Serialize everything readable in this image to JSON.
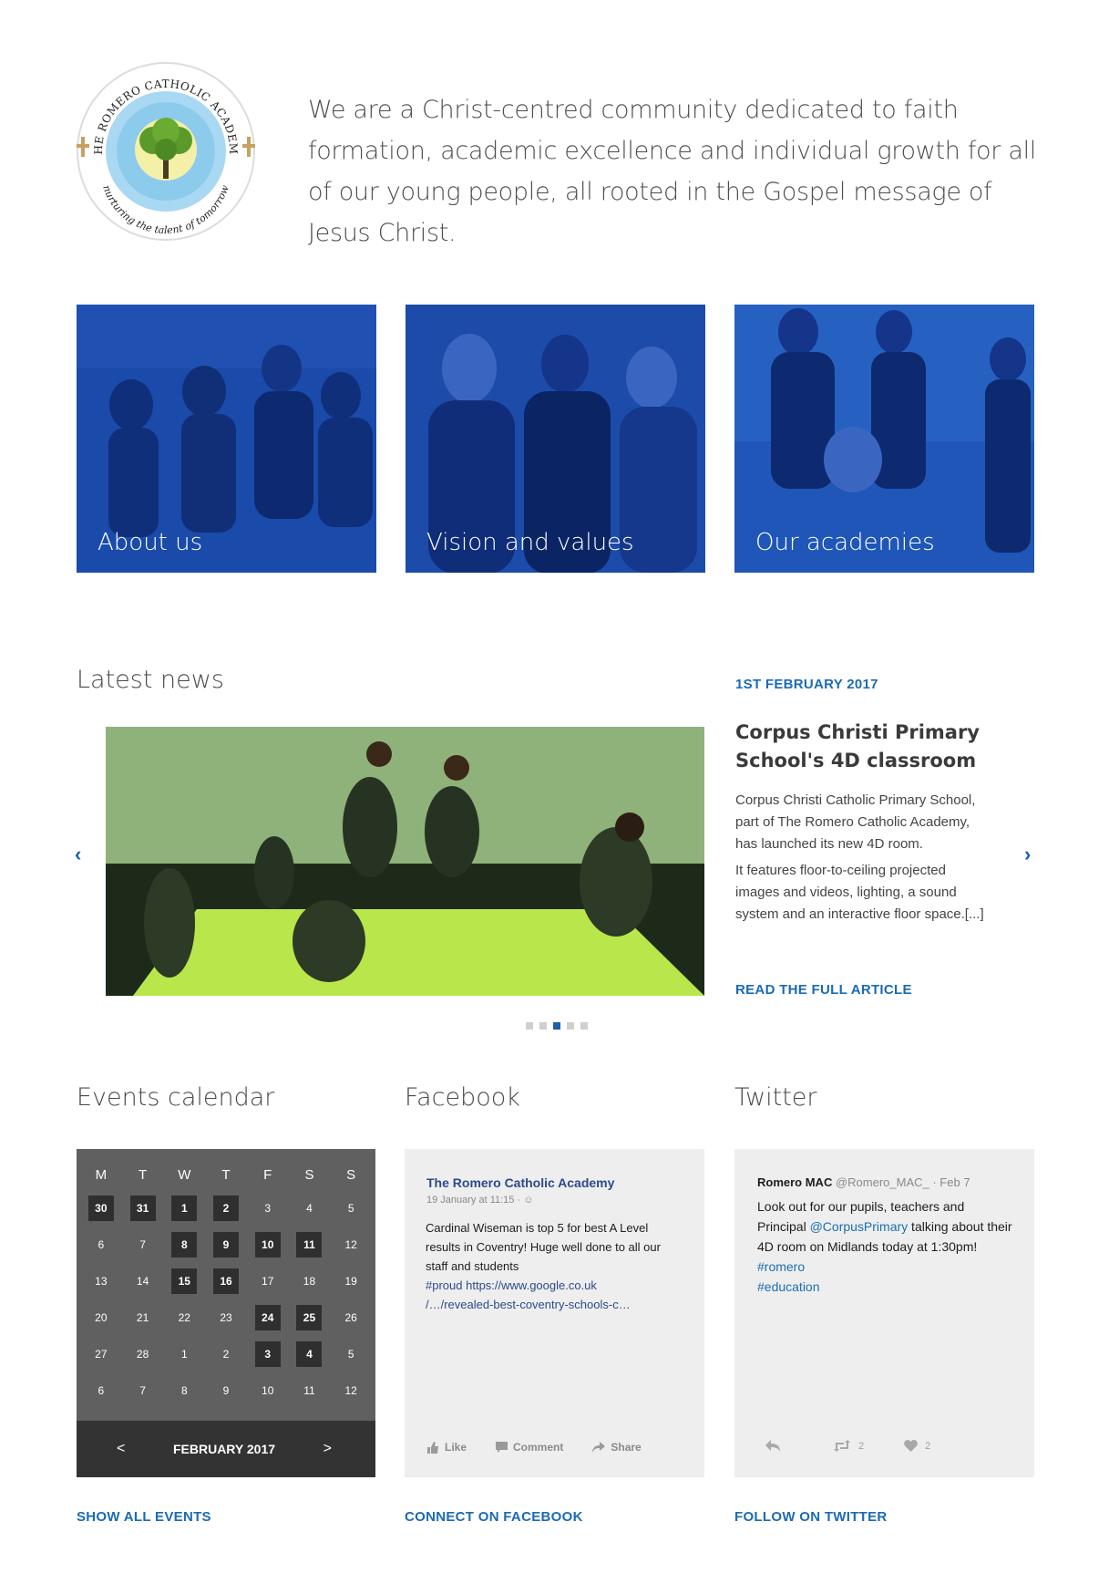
{
  "header": {
    "logo_text_top": "THE ROMERO CATHOLIC ACADEMY",
    "logo_text_bottom": "nurturing the talent of tomorrow",
    "mission": "We are a Christ-centred community dedicated to faith formation, academic excellence and individual growth for all of our young people, all rooted in the Gospel message of Jesus Christ."
  },
  "tiles": [
    {
      "label": "About us"
    },
    {
      "label": "Vision and values"
    },
    {
      "label": "Our academies"
    }
  ],
  "news": {
    "heading": "Latest news",
    "date": "1ST FEBRUARY 2017",
    "title": "Corpus Christi Primary School's 4D classroom",
    "body": [
      "Corpus Christi Catholic Primary School, part of The Romero Catholic Academy, has launched its new 4D room.",
      "It features floor-to-ceiling projected images and videos, lighting, a sound system and an interactive floor space.[...]"
    ],
    "read_more": "READ THE FULL ARTICLE",
    "prev": "‹",
    "next": "›",
    "slides": 5,
    "active_slide": 3
  },
  "events": {
    "heading": "Events calendar",
    "weekdays": [
      "M",
      "T",
      "W",
      "T",
      "F",
      "S",
      "S"
    ],
    "weeks": [
      [
        {
          "d": "30",
          "e": true
        },
        {
          "d": "31",
          "e": true
        },
        {
          "d": "1",
          "e": true
        },
        {
          "d": "2",
          "e": true
        },
        {
          "d": "3",
          "e": false
        },
        {
          "d": "4",
          "e": false
        },
        {
          "d": "5",
          "e": false
        }
      ],
      [
        {
          "d": "6",
          "e": false
        },
        {
          "d": "7",
          "e": false
        },
        {
          "d": "8",
          "e": true
        },
        {
          "d": "9",
          "e": true
        },
        {
          "d": "10",
          "e": true
        },
        {
          "d": "11",
          "e": true
        },
        {
          "d": "12",
          "e": false
        }
      ],
      [
        {
          "d": "13",
          "e": false
        },
        {
          "d": "14",
          "e": false
        },
        {
          "d": "15",
          "e": true
        },
        {
          "d": "16",
          "e": true
        },
        {
          "d": "17",
          "e": false
        },
        {
          "d": "18",
          "e": false
        },
        {
          "d": "19",
          "e": false
        }
      ],
      [
        {
          "d": "20",
          "e": false
        },
        {
          "d": "21",
          "e": false
        },
        {
          "d": "22",
          "e": false
        },
        {
          "d": "23",
          "e": false
        },
        {
          "d": "24",
          "e": true
        },
        {
          "d": "25",
          "e": true
        },
        {
          "d": "26",
          "e": false
        }
      ],
      [
        {
          "d": "27",
          "e": false
        },
        {
          "d": "28",
          "e": false
        },
        {
          "d": "1",
          "e": false
        },
        {
          "d": "2",
          "e": false
        },
        {
          "d": "3",
          "e": true
        },
        {
          "d": "4",
          "e": true
        },
        {
          "d": "5",
          "e": false
        }
      ],
      [
        {
          "d": "6",
          "e": false
        },
        {
          "d": "7",
          "e": false
        },
        {
          "d": "8",
          "e": false
        },
        {
          "d": "9",
          "e": false
        },
        {
          "d": "10",
          "e": false
        },
        {
          "d": "11",
          "e": false
        },
        {
          "d": "12",
          "e": false
        }
      ]
    ],
    "prev": "<",
    "next": ">",
    "month": "FEBRUARY 2017",
    "link": "SHOW ALL EVENTS"
  },
  "facebook": {
    "heading": "Facebook",
    "page_name": "The Romero Catholic Academy",
    "time": "19 January at 11:15 · ",
    "text": "Cardinal Wiseman is top 5 for best A Level results in Coventry! Huge well done to all our staff and students",
    "hashtag": "#proud",
    "url": "https://www.google.co.uk /…/revealed-best-coventry-schools-c…",
    "like": "Like",
    "comment": "Comment",
    "share": "Share",
    "link": "CONNECT ON FACEBOOK"
  },
  "twitter": {
    "heading": "Twitter",
    "name": "Romero MAC",
    "handle": "@Romero_MAC_",
    "date": " · Feb 7",
    "text_1": "Look out for our pupils, teachers and Principal ",
    "mention": "@CorpusPrimary",
    "text_2": " talking about their 4D room on Midlands today at 1:30pm! ",
    "tag_1": "#romero",
    "tag_2": "#education",
    "retweets": "2",
    "likes": "2",
    "link": "FOLLOW ON TWITTER"
  },
  "colors": {
    "accent": "#1b6bb5",
    "tile_blue": "#1746a8",
    "calendar_bg": "#606060",
    "calendar_footer": "#333333",
    "event_day": "#2f2f2f"
  }
}
